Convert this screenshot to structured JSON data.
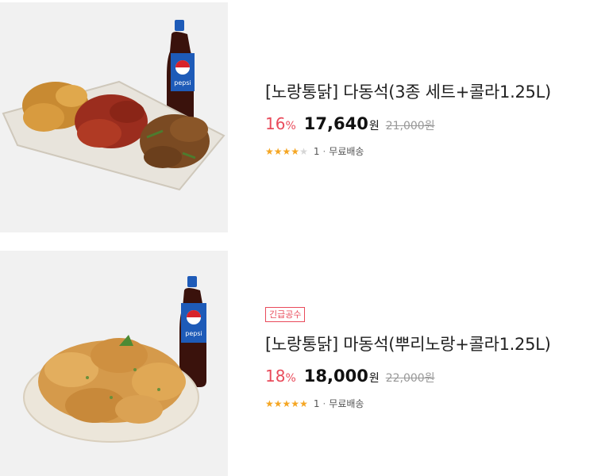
{
  "products": [
    {
      "title": "[노랑통닭] 다동석(3종 세트+콜라1.25L)",
      "discount_rate": "16",
      "percent_sign": "%",
      "sale_price": "17,640",
      "currency": "원",
      "original_price": "21,000원",
      "rating_value": 4,
      "rating_max": 5,
      "review_count": "1",
      "separator": "·",
      "shipping": "무료배송",
      "badge": "",
      "image": "fried-chicken-platter-with-pepsi"
    },
    {
      "title": "[노랑통닭] 마동석(뿌리노랑+콜라1.25L)",
      "discount_rate": "18",
      "percent_sign": "%",
      "sale_price": "18,000",
      "currency": "원",
      "original_price": "22,000원",
      "rating_value": 5,
      "rating_max": 5,
      "review_count": "1",
      "separator": "·",
      "shipping": "무료배송",
      "badge": "긴급공수",
      "image": "seasoned-chicken-plate-with-pepsi"
    }
  ],
  "colors": {
    "accent": "#e94b5b",
    "star": "#f5a623",
    "star_empty": "#d6d6d6",
    "pepsi_blue": "#1e5bb8"
  }
}
